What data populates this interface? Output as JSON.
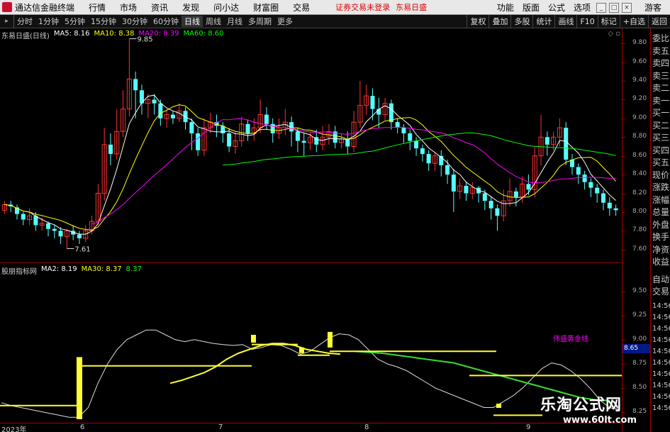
{
  "menubar": {
    "app_title": "通达信金融终端",
    "items": [
      "行情",
      "市场",
      "资讯",
      "发现",
      "问小达",
      "财富圈",
      "交易"
    ],
    "notice": "证券交易未登录",
    "notice2": "东易日盛",
    "right": [
      "功能",
      "版面",
      "公式",
      "选项"
    ],
    "guest": "游客"
  },
  "toolbar": {
    "periods": [
      "分时",
      "1分钟",
      "5分钟",
      "15分钟",
      "30分钟",
      "60分钟",
      "日线",
      "周线",
      "月线",
      "多周期",
      "更多"
    ],
    "active": "日线",
    "tools": [
      "复权",
      "叠加",
      "多股",
      "统计",
      "画线",
      "F10",
      "标记",
      "+自选",
      "返回"
    ]
  },
  "legend": {
    "stock": "东易日盛(日线)",
    "ma5": "MA5: 8.16",
    "ma10": "MA10: 8.38",
    "ma20": "MA20: 8.39",
    "ma60": "MA60: 8.60"
  },
  "legend2": {
    "ind": "股朋指标网",
    "ma2": "MA2: 8.19",
    "ma30": "MA30: 8.37",
    "val": "8.37"
  },
  "price_axis": [
    "9.80",
    "9.60",
    "9.40",
    "9.20",
    "9.00",
    "8.80",
    "8.60",
    "8.40",
    "8.20",
    "8.00",
    "7.80",
    "7.60"
  ],
  "sub_axis": [
    "9.50",
    "9.25",
    "9.00",
    "8.75",
    "8.50",
    "8.25"
  ],
  "current_marker": "8.65",
  "annotations": {
    "high": "9.85",
    "low": "7.61"
  },
  "panel_labels": [
    "委比",
    "卖五",
    "卖四",
    "卖三",
    "卖二",
    "卖一",
    "买一",
    "买二",
    "买三",
    "买四",
    "买五",
    "现价",
    "涨跌",
    "涨幅",
    "总量",
    "外盘",
    "换手",
    "净资",
    "收益"
  ],
  "panel_lower": [
    "自动",
    "交易"
  ],
  "panel_times": [
    "14:56",
    "14:56",
    "14:56",
    "14:56",
    "14:56",
    "14:56",
    "14:56",
    "14:56",
    "14:56",
    "14:56"
  ],
  "dates": [
    "2023年",
    "6",
    "7",
    "8",
    "9"
  ],
  "sub_label": "伟盛黄金线",
  "watermark": {
    "title": "乐淘公式网",
    "url": "www.60lt.com"
  },
  "chart_data": {
    "type": "candlestick",
    "title": "东易日盛(日线)",
    "ylim": [
      7.5,
      9.9
    ],
    "ticks": [
      9.8,
      9.6,
      9.4,
      9.2,
      9.0,
      8.8,
      8.6,
      8.4,
      8.2,
      8.0,
      7.8,
      7.6
    ],
    "candles": [
      [
        8.02,
        8.08,
        7.98,
        8.12
      ],
      [
        8.08,
        8.06,
        8.0,
        8.12
      ],
      [
        8.05,
        7.98,
        7.92,
        8.08
      ],
      [
        7.98,
        7.92,
        7.86,
        8.0
      ],
      [
        7.92,
        7.96,
        7.86,
        8.04
      ],
      [
        7.96,
        7.86,
        7.8,
        8.0
      ],
      [
        7.86,
        7.88,
        7.8,
        7.94
      ],
      [
        7.88,
        7.82,
        7.74,
        7.9
      ],
      [
        7.82,
        7.8,
        7.72,
        7.86
      ],
      [
        7.8,
        7.74,
        7.66,
        7.84
      ],
      [
        7.74,
        7.8,
        7.61,
        7.82
      ],
      [
        7.8,
        7.76,
        7.7,
        7.86
      ],
      [
        7.76,
        7.72,
        7.66,
        7.8
      ],
      [
        7.72,
        7.8,
        7.68,
        7.86
      ],
      [
        7.8,
        7.9,
        7.76,
        7.96
      ],
      [
        7.9,
        8.2,
        7.86,
        8.3
      ],
      [
        8.2,
        8.72,
        8.12,
        8.9
      ],
      [
        8.72,
        8.62,
        8.5,
        8.84
      ],
      [
        8.62,
        8.86,
        8.56,
        9.1
      ],
      [
        8.86,
        9.1,
        8.8,
        9.3
      ],
      [
        9.1,
        9.42,
        9.02,
        9.85
      ],
      [
        9.42,
        9.3,
        9.0,
        9.5
      ],
      [
        9.3,
        9.16,
        9.04,
        9.36
      ],
      [
        9.16,
        9.2,
        9.0,
        9.26
      ],
      [
        9.2,
        9.16,
        9.04,
        9.26
      ],
      [
        9.16,
        9.0,
        8.92,
        9.2
      ],
      [
        9.0,
        9.04,
        8.9,
        9.1
      ],
      [
        9.04,
        9.0,
        8.94,
        9.08
      ],
      [
        9.0,
        9.08,
        8.96,
        9.16
      ],
      [
        9.08,
        8.96,
        8.88,
        9.12
      ],
      [
        8.96,
        8.84,
        8.66,
        9.0
      ],
      [
        8.84,
        8.66,
        8.6,
        8.9
      ],
      [
        8.66,
        8.9,
        8.6,
        9.0
      ],
      [
        8.9,
        8.96,
        8.84,
        9.06
      ],
      [
        8.96,
        8.92,
        8.8,
        9.04
      ],
      [
        8.92,
        8.84,
        8.74,
        8.96
      ],
      [
        8.84,
        8.7,
        8.64,
        8.9
      ],
      [
        8.7,
        8.76,
        8.62,
        8.86
      ],
      [
        8.76,
        8.94,
        8.7,
        9.02
      ],
      [
        8.94,
        8.84,
        8.76,
        8.98
      ],
      [
        8.84,
        8.9,
        8.76,
        9.0
      ],
      [
        8.9,
        9.04,
        8.84,
        9.2
      ],
      [
        9.04,
        8.94,
        8.88,
        9.12
      ],
      [
        8.94,
        8.84,
        8.74,
        9.0
      ],
      [
        8.84,
        8.9,
        8.78,
        9.0
      ],
      [
        8.9,
        8.96,
        8.82,
        9.1
      ],
      [
        8.96,
        8.86,
        8.7,
        9.02
      ],
      [
        8.86,
        8.76,
        8.64,
        8.9
      ],
      [
        8.76,
        8.74,
        8.6,
        8.84
      ],
      [
        8.74,
        8.8,
        8.66,
        8.86
      ],
      [
        8.8,
        8.72,
        8.64,
        8.88
      ],
      [
        8.72,
        8.8,
        8.66,
        8.92
      ],
      [
        8.8,
        8.86,
        8.72,
        8.94
      ],
      [
        8.86,
        8.74,
        8.68,
        8.92
      ],
      [
        8.74,
        8.78,
        8.68,
        8.84
      ],
      [
        8.78,
        8.7,
        8.62,
        8.86
      ],
      [
        8.7,
        8.96,
        8.64,
        9.08
      ],
      [
        8.96,
        9.14,
        8.9,
        9.4
      ],
      [
        9.14,
        9.24,
        9.04,
        9.36
      ],
      [
        9.24,
        9.1,
        8.98,
        9.32
      ],
      [
        9.1,
        9.04,
        8.9,
        9.22
      ],
      [
        9.04,
        9.16,
        8.98,
        9.22
      ],
      [
        9.16,
        8.96,
        8.88,
        9.2
      ],
      [
        8.96,
        8.9,
        8.84,
        9.0
      ],
      [
        8.9,
        8.84,
        8.74,
        8.94
      ],
      [
        8.84,
        8.76,
        8.66,
        8.88
      ],
      [
        8.76,
        8.68,
        8.6,
        8.8
      ],
      [
        8.68,
        8.62,
        8.54,
        8.72
      ],
      [
        8.62,
        8.52,
        8.44,
        8.66
      ],
      [
        8.52,
        8.6,
        8.44,
        8.64
      ],
      [
        8.6,
        8.5,
        8.38,
        8.66
      ],
      [
        8.5,
        8.4,
        8.3,
        8.56
      ],
      [
        8.4,
        8.22,
        8.0,
        8.46
      ],
      [
        8.22,
        8.28,
        8.14,
        8.36
      ],
      [
        8.28,
        8.2,
        8.12,
        8.32
      ],
      [
        8.2,
        8.26,
        8.14,
        8.32
      ],
      [
        8.26,
        8.2,
        8.1,
        8.28
      ],
      [
        8.2,
        8.12,
        8.02,
        8.24
      ],
      [
        8.12,
        8.04,
        7.92,
        8.16
      ],
      [
        8.04,
        7.96,
        7.8,
        8.08
      ],
      [
        7.96,
        8.12,
        7.9,
        8.24
      ],
      [
        8.12,
        8.22,
        8.06,
        8.36
      ],
      [
        8.22,
        8.16,
        8.06,
        8.26
      ],
      [
        8.16,
        8.3,
        8.1,
        8.38
      ],
      [
        8.3,
        8.24,
        8.18,
        8.4
      ],
      [
        8.24,
        8.6,
        8.16,
        8.7
      ],
      [
        8.6,
        8.8,
        8.5,
        9.04
      ],
      [
        8.8,
        8.72,
        8.6,
        8.86
      ],
      [
        8.72,
        8.8,
        8.66,
        8.86
      ],
      [
        8.8,
        8.9,
        8.7,
        9.0
      ],
      [
        8.9,
        8.56,
        8.5,
        8.96
      ],
      [
        8.56,
        8.48,
        8.4,
        8.62
      ],
      [
        8.48,
        8.4,
        8.3,
        8.52
      ],
      [
        8.4,
        8.32,
        8.24,
        8.44
      ],
      [
        8.32,
        8.26,
        8.16,
        8.36
      ],
      [
        8.26,
        8.2,
        8.1,
        8.3
      ],
      [
        8.2,
        8.1,
        8.02,
        8.24
      ],
      [
        8.1,
        8.04,
        7.96,
        8.16
      ],
      [
        8.04,
        8.02,
        7.96,
        8.08
      ]
    ],
    "series": [
      {
        "name": "MA5",
        "color": "#ffffff"
      },
      {
        "name": "MA10",
        "color": "#ffff00"
      },
      {
        "name": "MA20",
        "color": "#ff00ff"
      },
      {
        "name": "MA60",
        "color": "#00ff00"
      }
    ],
    "sub": {
      "ylim": [
        8.15,
        9.65
      ],
      "ticks": [
        9.5,
        9.25,
        9.0,
        8.75,
        8.5,
        8.25
      ],
      "white_line": [
        8.35,
        8.32,
        8.3,
        8.28,
        8.26,
        8.24,
        8.22,
        8.2,
        8.2,
        8.3,
        8.55,
        8.75,
        8.9,
        9.0,
        9.05,
        9.1,
        9.1,
        9.05,
        9.0,
        8.98,
        9.0,
        8.98,
        8.96,
        8.95,
        8.94,
        8.95,
        8.9,
        8.92,
        8.95,
        8.94,
        8.9,
        8.85,
        8.88,
        8.95,
        9.02,
        9.06,
        9.05,
        9.0,
        8.9,
        8.8,
        8.75,
        8.72,
        8.68,
        8.62,
        8.56,
        8.5,
        8.46,
        8.42,
        8.38,
        8.34,
        8.3,
        8.3,
        8.36,
        8.42,
        8.5,
        8.6,
        8.7,
        8.76,
        8.74,
        8.68,
        8.6,
        8.5,
        8.38,
        8.3,
        8.28
      ],
      "yellow_curve": [
        8.55,
        8.58,
        8.62,
        8.66,
        8.72,
        8.8,
        8.86,
        8.9,
        8.94,
        8.96,
        8.96,
        8.94,
        8.9,
        8.88,
        8.86,
        8.85
      ],
      "green_curve": [
        8.88,
        8.87,
        8.86,
        8.84,
        8.82,
        8.8,
        8.78,
        8.76,
        8.72,
        8.68,
        8.64,
        8.6,
        8.56,
        8.52,
        8.48,
        8.44,
        8.4,
        8.38,
        8.37
      ]
    }
  }
}
